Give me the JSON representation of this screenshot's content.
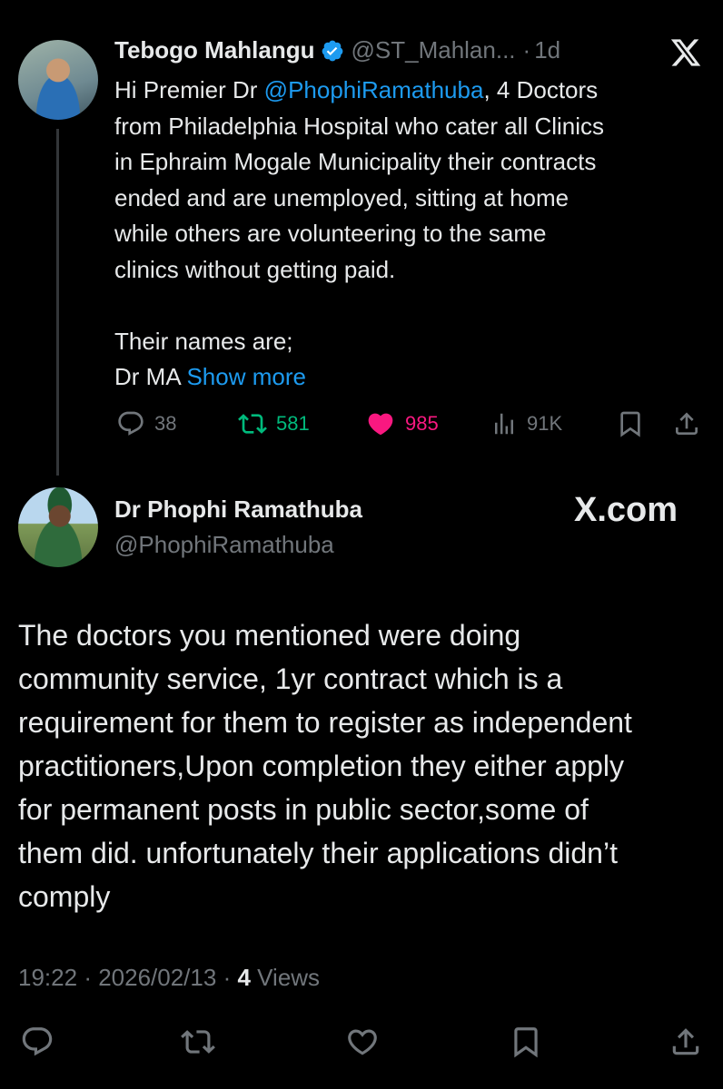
{
  "reply_to": {
    "author_name": "Tebogo Mahlangu",
    "handle": "@ST_Mahlan...",
    "separator": "·",
    "time_ago": "1d",
    "text_prefix": "Hi Premier Dr ",
    "mention": "@PhophiRamathuba",
    "text_after_mention": ", 4 Doctors",
    "lines": [
      "from Philadelphia Hospital who cater all Clinics",
      "in Ephraim Mogale Municipality their contracts",
      "ended and are unemployed, sitting at home",
      "while others are volunteering to the same",
      "clinics without getting paid."
    ],
    "line_names": "Their names are;",
    "line_last_prefix": "Dr MA ",
    "show_more": "Show more",
    "stats": {
      "replies": "38",
      "retweets": "581",
      "likes": "985",
      "views": "91K"
    }
  },
  "tweet": {
    "author_name": "Dr Phophi Ramathuba",
    "handle": "@PhophiRamathuba",
    "brand": "X.com",
    "lines": [
      "The doctors you mentioned were doing",
      "community service, 1yr contract which is a",
      "requirement for them  to register as independent",
      "practitioners,Upon completion they either apply",
      "for permanent posts in public sector,some of",
      "them did. unfortunately their applications didn’t",
      "comply"
    ],
    "time": "19:22",
    "date": "2026/02/13",
    "views_count": "4",
    "views_label": "Views"
  },
  "colors": {
    "background": "#000000",
    "text": "#e7e9ea",
    "muted": "#71767b",
    "link": "#1d9bf0",
    "retweet": "#00ba7c",
    "like": "#f91880",
    "verified": "#1d9bf0"
  },
  "icons": [
    "x-logo-icon",
    "verified-badge-icon",
    "reply-icon",
    "retweet-icon",
    "like-icon",
    "views-icon",
    "bookmark-icon",
    "share-icon"
  ]
}
